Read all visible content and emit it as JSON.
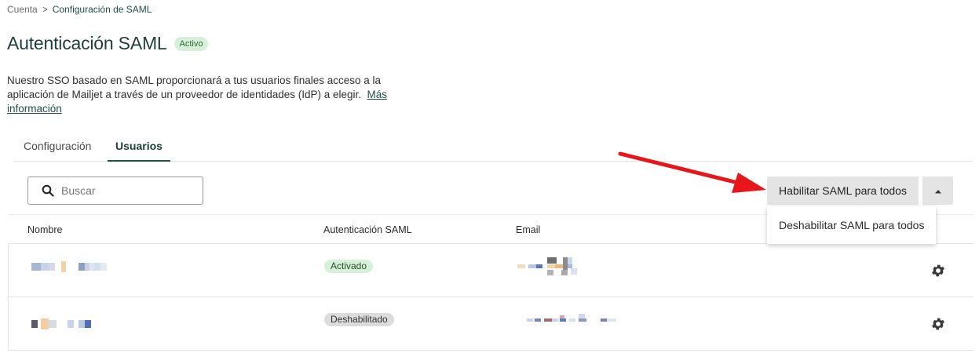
{
  "breadcrumb": {
    "parent": "Cuenta",
    "separator": ">",
    "current": "Configuración de SAML"
  },
  "header": {
    "title": "Autenticación SAML",
    "status_badge": "Activo"
  },
  "description": {
    "text": "Nuestro SSO basado en SAML proporcionará a tus usuarios finales acceso a la aplicación de Mailjet a través de un proveedor de identidades (IdP) a elegir.",
    "link": "Más información"
  },
  "tabs": [
    {
      "label": "Configuración",
      "active": false
    },
    {
      "label": "Usuarios",
      "active": true
    }
  ],
  "search": {
    "placeholder": "Buscar",
    "value": ""
  },
  "actions": {
    "enable_all": "Habilitar SAML para todos",
    "menu_items": [
      "Deshabilitar SAML para todos"
    ],
    "toggle_icon": "caret-up-icon"
  },
  "table": {
    "columns": [
      "Nombre",
      "Autenticación SAML",
      "Email"
    ],
    "rows": [
      {
        "name": "[redacted]",
        "saml_status": "Activado",
        "email": "[redacted]"
      },
      {
        "name": "[redacted]",
        "saml_status": "Deshabilitado",
        "email": "[redacted]"
      }
    ]
  },
  "colors": {
    "accent": "#1f4f4a",
    "badge_active_bg": "#d7f0d9",
    "badge_disabled_bg": "#dcdcdc",
    "button_bg": "#e4e4e4",
    "annotation_arrow": "#e8161b"
  }
}
